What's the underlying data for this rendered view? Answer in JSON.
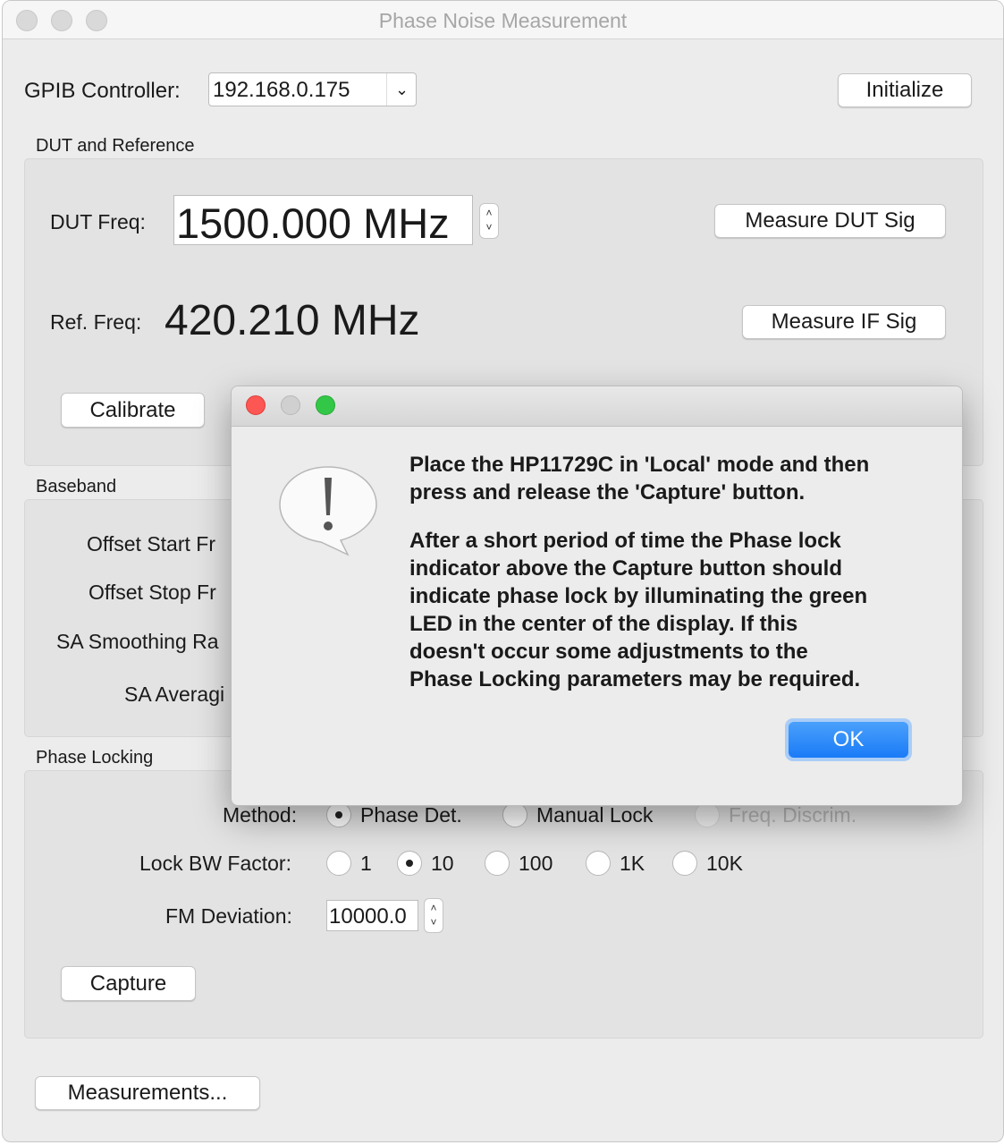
{
  "window": {
    "title": "Phase Noise Measurement"
  },
  "gpib": {
    "label": "GPIB Controller:",
    "value": "192.168.0.175",
    "initialize": "Initialize"
  },
  "dut": {
    "group_title": "DUT and Reference",
    "dut_label": "DUT Freq:",
    "dut_value": "1500.000 MHz",
    "measure_dut": "Measure DUT Sig",
    "ref_label": "Ref. Freq:",
    "ref_value": "420.210 MHz",
    "measure_if": "Measure IF Sig",
    "calibrate": "Calibrate"
  },
  "baseband": {
    "group_title": "Baseband",
    "rows": [
      "Offset Start Fr",
      "Offset Stop Fr",
      "SA Smoothing Ra",
      "SA Averagi"
    ]
  },
  "phase_locking": {
    "group_title": "Phase Locking",
    "method_label": "Method:",
    "methods": [
      {
        "label": "Phase Det.",
        "selected": true
      },
      {
        "label": "Manual Lock",
        "selected": false
      },
      {
        "label": "Freq. Discrim.",
        "selected": false,
        "disabled": true
      }
    ],
    "bw_label": "Lock BW Factor:",
    "bw_options": [
      {
        "label": "1",
        "selected": false
      },
      {
        "label": "10",
        "selected": true
      },
      {
        "label": "100",
        "selected": false
      },
      {
        "label": "1K",
        "selected": false
      },
      {
        "label": "10K",
        "selected": false
      }
    ],
    "fm_label": "FM Deviation:",
    "fm_value": "10000.0",
    "capture": "Capture"
  },
  "measurements": "Measurements...",
  "dialog": {
    "icon": "exclamation-speech-bubble-icon",
    "para1": [
      "Place the HP11729C in 'Local' mode and then",
      "press and release the 'Capture' button."
    ],
    "para2": [
      "After a short period of time the Phase lock",
      "indicator above the Capture button should",
      "indicate phase lock by illuminating the green",
      "LED in the center of the display. If this",
      "doesn't occur some adjustments to the",
      "Phase Locking parameters may be required."
    ],
    "ok": "OK",
    "ok_color": "#1a7bf7"
  }
}
